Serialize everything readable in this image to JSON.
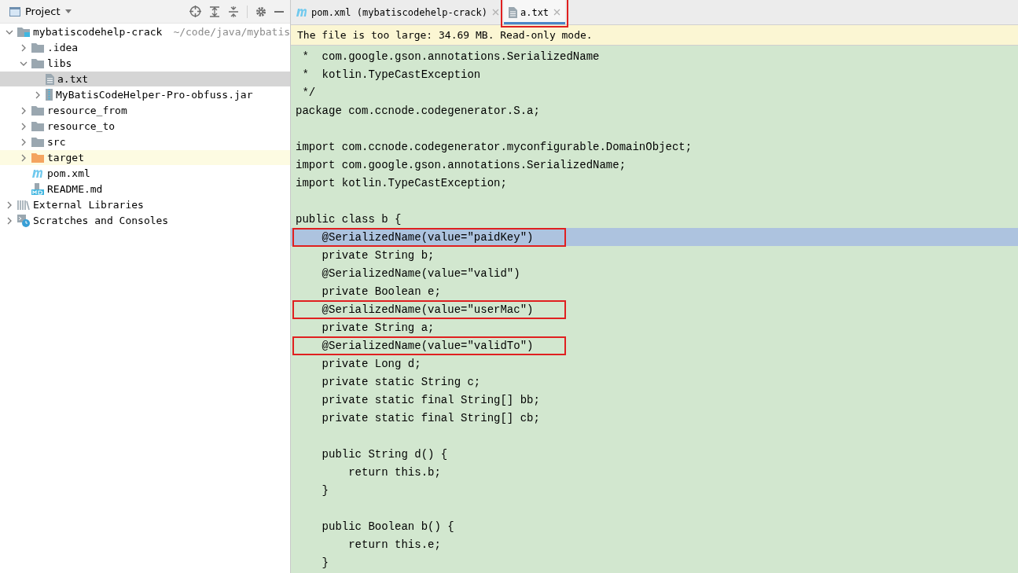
{
  "project_panel": {
    "title": "Project",
    "tree": [
      {
        "label": "mybatiscodehelp-crack",
        "path": "~/code/java/mybatis",
        "kind": "module",
        "expanded": true,
        "selected": false,
        "excluded": false,
        "children": [
          {
            "label": ".idea",
            "kind": "folder",
            "expanded": false,
            "selected": false,
            "excluded": false
          },
          {
            "label": "libs",
            "kind": "folder",
            "expanded": true,
            "selected": false,
            "excluded": false,
            "children": [
              {
                "label": "a.txt",
                "kind": "text",
                "selected": true,
                "excluded": false
              },
              {
                "label": "MyBatisCodeHelper-Pro-obfuss.jar",
                "kind": "jar",
                "expanded": false,
                "selected": false,
                "excluded": false
              }
            ]
          },
          {
            "label": "resource_from",
            "kind": "folder",
            "expanded": false,
            "selected": false,
            "excluded": false
          },
          {
            "label": "resource_to",
            "kind": "folder",
            "expanded": false,
            "selected": false,
            "excluded": false
          },
          {
            "label": "src",
            "kind": "folder",
            "expanded": false,
            "selected": false,
            "excluded": false
          },
          {
            "label": "target",
            "kind": "folder",
            "expanded": false,
            "selected": false,
            "excluded": true
          },
          {
            "label": "pom.xml",
            "kind": "maven",
            "selected": false,
            "excluded": false
          },
          {
            "label": "README.md",
            "kind": "markdown",
            "selected": false,
            "excluded": false
          }
        ]
      },
      {
        "label": "External Libraries",
        "kind": "libraries",
        "expanded": false,
        "selected": false,
        "excluded": false
      },
      {
        "label": "Scratches and Consoles",
        "kind": "scratches",
        "expanded": false,
        "selected": false,
        "excluded": false
      }
    ]
  },
  "tabs": [
    {
      "label": "pom.xml (mybatiscodehelp-crack)",
      "kind": "maven",
      "selected": false,
      "annotated": false
    },
    {
      "label": "a.txt",
      "kind": "text",
      "selected": true,
      "annotated": true
    }
  ],
  "banner": "The file is too large: 34.69 MB. Read-only mode.",
  "code_lines": [
    {
      "text": " *  com.google.gson.annotations.SerializedName",
      "current": false,
      "annotated": false
    },
    {
      "text": " *  kotlin.TypeCastException",
      "current": false,
      "annotated": false
    },
    {
      "text": " */",
      "current": false,
      "annotated": false
    },
    {
      "text": "package com.ccnode.codegenerator.S.a;",
      "current": false,
      "annotated": false
    },
    {
      "current": false
    },
    {
      "text": "import com.ccnode.codegenerator.myconfigurable.DomainObject;",
      "current": false,
      "annotated": false
    },
    {
      "text": "import com.google.gson.annotations.SerializedName;",
      "current": false,
      "annotated": false
    },
    {
      "text": "import kotlin.TypeCastException;",
      "current": false,
      "annotated": false
    },
    {
      "current": false
    },
    {
      "text": "public class b {",
      "current": false,
      "annotated": false
    },
    {
      "text": "    @SerializedName(value=\"paidKey\")",
      "current": true,
      "annotated": true
    },
    {
      "text": "    private String b;",
      "current": false,
      "annotated": false
    },
    {
      "text": "    @SerializedName(value=\"valid\")",
      "current": false,
      "annotated": false
    },
    {
      "text": "    private Boolean e;",
      "current": false,
      "annotated": false
    },
    {
      "text": "    @SerializedName(value=\"userMac\")",
      "current": false,
      "annotated": true
    },
    {
      "text": "    private String a;",
      "current": false,
      "annotated": false
    },
    {
      "text": "    @SerializedName(value=\"validTo\")",
      "current": false,
      "annotated": true
    },
    {
      "text": "    private Long d;",
      "current": false,
      "annotated": false
    },
    {
      "text": "    private static String c;",
      "current": false,
      "annotated": false
    },
    {
      "text": "    private static final String[] bb;",
      "current": false,
      "annotated": false
    },
    {
      "text": "    private static final String[] cb;",
      "current": false,
      "annotated": false
    },
    {
      "current": false
    },
    {
      "text": "    public String d() {",
      "current": false,
      "annotated": false
    },
    {
      "text": "        return this.b;",
      "current": false,
      "annotated": false
    },
    {
      "text": "    }",
      "current": false,
      "annotated": false
    },
    {
      "current": false
    },
    {
      "text": "    public Boolean b() {",
      "current": false,
      "annotated": false
    },
    {
      "text": "        return this.e;",
      "current": false,
      "annotated": false
    },
    {
      "text": "    }",
      "current": false,
      "annotated": false
    }
  ]
}
